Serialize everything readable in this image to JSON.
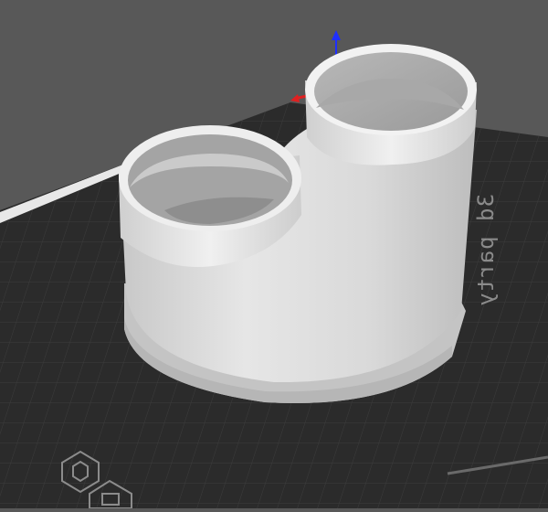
{
  "viewport": {
    "background": "#585858",
    "bed_color": "#2b2b2b",
    "grid_color": "#3e3e3e",
    "model_color": "#d6d6d6"
  },
  "bed": {
    "brand_text": "3d party"
  },
  "axes": {
    "z_color": "#1f2fff",
    "x_color": "#e02020"
  },
  "toolbar_icons": [
    {
      "name": "hex-nut-icon"
    },
    {
      "name": "printer-icon"
    }
  ]
}
